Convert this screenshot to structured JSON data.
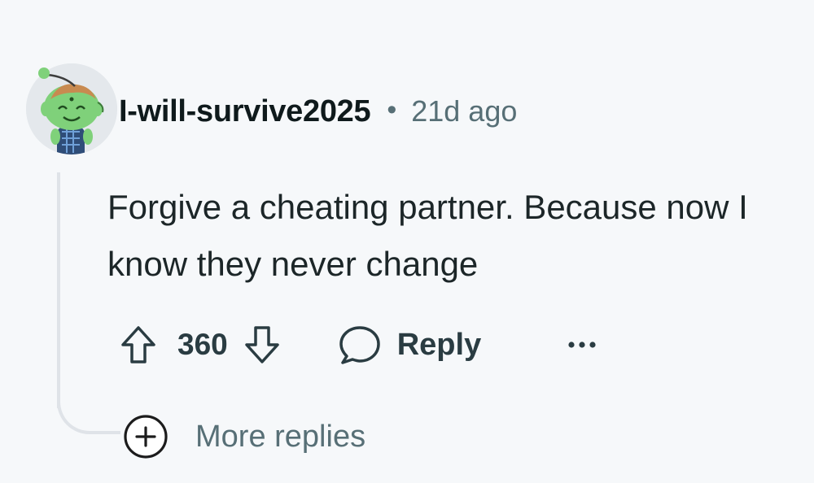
{
  "comment": {
    "author": "I-will-survive2025",
    "separator": "•",
    "timestamp": "21d ago",
    "body": "Forgive a cheating partner. Because now I know they never change",
    "score": "360",
    "reply_label": "Reply"
  },
  "more_replies": {
    "label": "More replies"
  },
  "icons": {
    "avatar": "snoo-avatar-green",
    "upvote": "arrow-up-icon",
    "downvote": "arrow-down-icon",
    "reply": "speech-bubble-icon",
    "overflow": "ellipsis-icon",
    "expand": "plus-circle-icon"
  },
  "colors": {
    "background": "#f6f8fa",
    "muted_text": "#576f76",
    "thread_line": "#dfe3e8",
    "avatar_green": "#7fd17a"
  }
}
